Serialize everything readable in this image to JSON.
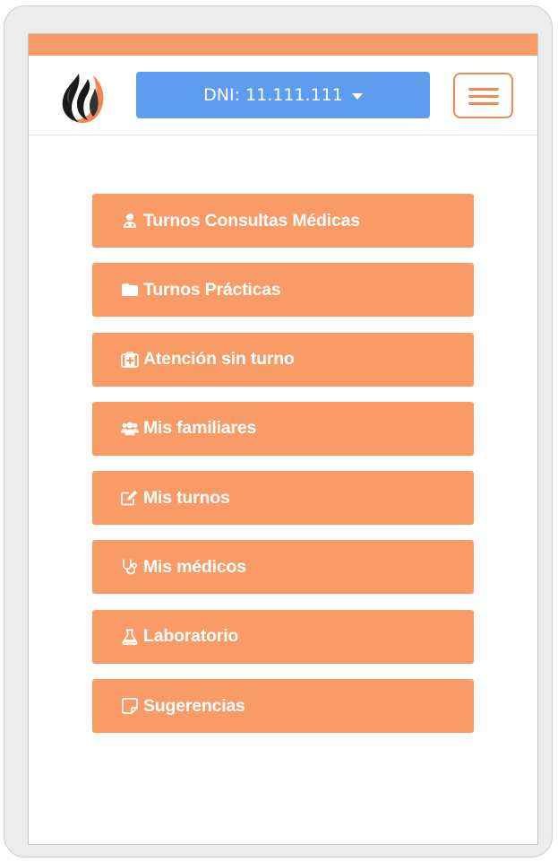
{
  "header": {
    "dni_label": "DNI: 11.111.111"
  },
  "menu": {
    "items": [
      {
        "label": "Turnos Consultas Médicas",
        "icon": "doctor-icon"
      },
      {
        "label": "Turnos Prácticas",
        "icon": "folder-icon"
      },
      {
        "label": "Atención sin turno",
        "icon": "medkit-icon"
      },
      {
        "label": "Mis familiares",
        "icon": "users-icon"
      },
      {
        "label": "Mis turnos",
        "icon": "edit-icon"
      },
      {
        "label": "Mis médicos",
        "icon": "stethoscope-icon"
      },
      {
        "label": "Laboratorio",
        "icon": "flask-icon"
      },
      {
        "label": "Sugerencias",
        "icon": "note-icon"
      }
    ]
  },
  "colors": {
    "accent": "#f89b66",
    "dni_button": "#5e9ded",
    "toggle_border": "#f08a55"
  }
}
